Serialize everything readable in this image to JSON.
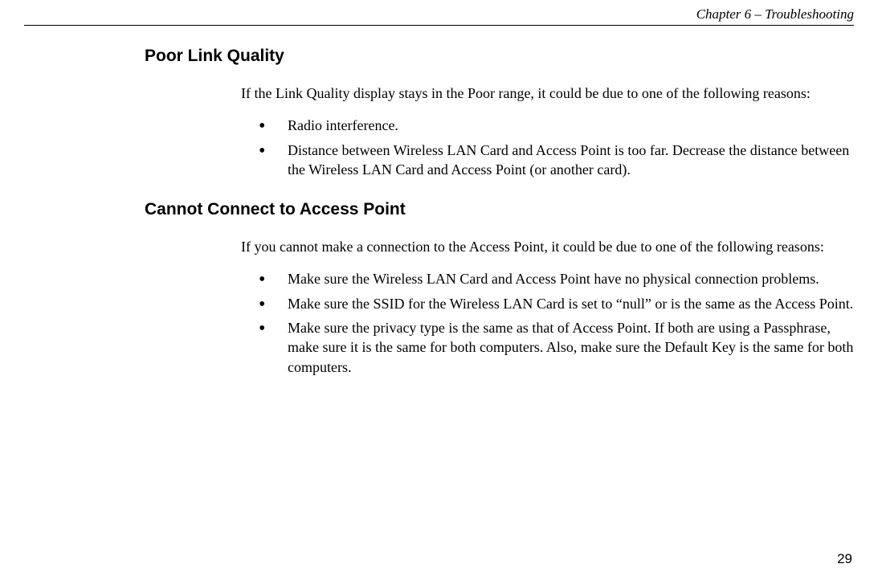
{
  "header": {
    "chapter_label": "Chapter 6 – Troubleshooting"
  },
  "sections": {
    "poor_link": {
      "heading": "Poor Link Quality",
      "intro": "If the Link Quality display stays in the Poor range, it could be due to one of the following reasons:",
      "bullets": [
        "Radio interference.",
        "Distance between Wireless LAN Card and Access Point is too far. Decrease the distance between the Wireless LAN Card and Access Point (or another card)."
      ]
    },
    "cannot_connect": {
      "heading": "Cannot Connect to Access Point",
      "intro": "If you cannot make a connection to the Access Point, it could be due to one of the following reasons:",
      "bullets": [
        "Make sure the Wireless LAN Card and Access Point have no physical connection problems.",
        "Make sure the SSID for the Wireless LAN Card is set to “null” or is the same as the Access Point.",
        "Make sure the privacy type is the same as that of Access Point. If both are using a Passphrase, make sure it is the same for both computers. Also, make sure the Default Key is the same for both computers."
      ]
    }
  },
  "footer": {
    "page_number": "29"
  }
}
